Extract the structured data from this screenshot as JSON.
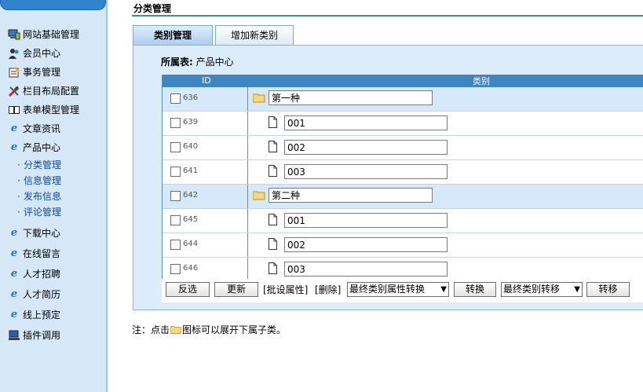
{
  "sidebar": {
    "items": [
      {
        "icon": "monitor-icon",
        "label": "网站基础管理"
      },
      {
        "icon": "users-icon",
        "label": "会员中心"
      },
      {
        "icon": "notepad-icon",
        "label": "事务管理"
      },
      {
        "icon": "tools-icon",
        "label": "栏目布局配置"
      },
      {
        "icon": "book-icon",
        "label": "表单模型管理"
      },
      {
        "icon": "ie-icon",
        "label": "文章资讯"
      },
      {
        "icon": "ie-icon",
        "label": "产品中心"
      }
    ],
    "sub_items": [
      "分类管理",
      "信息管理",
      "发布信息",
      "评论管理"
    ],
    "items_after": [
      {
        "icon": "ie-icon",
        "label": "下载中心"
      },
      {
        "icon": "ie-icon",
        "label": "在线留言"
      },
      {
        "icon": "ie-icon",
        "label": "人才招聘"
      },
      {
        "icon": "ie-icon",
        "label": "人才简历"
      },
      {
        "icon": "ie-icon",
        "label": "线上预定"
      },
      {
        "icon": "computer-icon",
        "label": "插件调用"
      }
    ]
  },
  "main": {
    "title": "分类管理",
    "tabs": [
      {
        "label": "类别管理"
      },
      {
        "label": "增加新类别"
      }
    ],
    "belong_label": "所属表:",
    "belong_value": "产品中心",
    "columns": {
      "id": "ID",
      "category": "类别"
    },
    "rows": [
      {
        "id": "636",
        "name": "第一种",
        "type": "parent"
      },
      {
        "id": "639",
        "name": "001",
        "type": "child"
      },
      {
        "id": "640",
        "name": "002",
        "type": "child"
      },
      {
        "id": "641",
        "name": "003",
        "type": "child"
      },
      {
        "id": "642",
        "name": "第二种",
        "type": "parent"
      },
      {
        "id": "645",
        "name": "001",
        "type": "child"
      },
      {
        "id": "644",
        "name": "002",
        "type": "child"
      },
      {
        "id": "646",
        "name": "003",
        "type": "child"
      }
    ],
    "toolbar": {
      "invert_label": "反选",
      "refresh_label": "更新",
      "batch_attr_label": "[批设属性]",
      "delete_label": "[删除]",
      "attr_convert_select": "最终类别属性转换",
      "convert_label": "转换",
      "move_select": "最终类别转移",
      "move_label": "转移"
    },
    "note_prefix": "注：点击",
    "note_suffix": "图标可以展开下属子类。"
  },
  "colors": {
    "accent": "#3f86c0",
    "sidebar_bg": "#d6e8f8",
    "panel_bg": "#dcecfb",
    "rule": "#3a9a73"
  }
}
